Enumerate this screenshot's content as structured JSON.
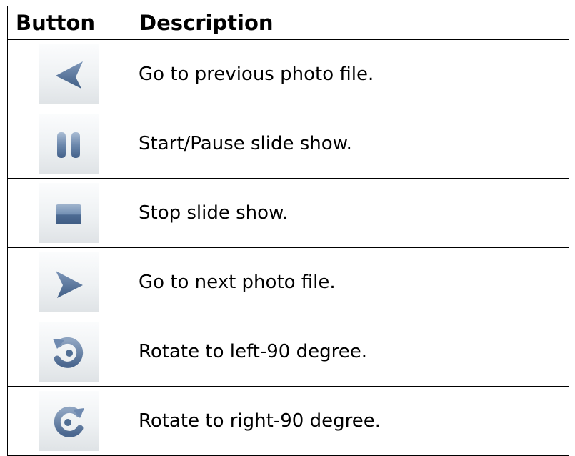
{
  "table": {
    "headers": {
      "button": "Button",
      "description": "Description"
    },
    "rows": [
      {
        "icon": "previous-arrow-icon",
        "description": "Go to previous photo file."
      },
      {
        "icon": "pause-icon",
        "description": "Start/Pause slide show."
      },
      {
        "icon": "stop-icon",
        "description": "Stop slide show."
      },
      {
        "icon": "next-arrow-icon",
        "description": "Go to next photo file."
      },
      {
        "icon": "rotate-left-icon",
        "description": "Rotate to left-90 degree."
      },
      {
        "icon": "rotate-right-icon",
        "description": "Rotate to right-90 degree."
      }
    ]
  },
  "colors": {
    "icon_blue": "#4f6d93",
    "icon_highlight": "#8fa6c3",
    "button_bg": "#eef1f3"
  }
}
